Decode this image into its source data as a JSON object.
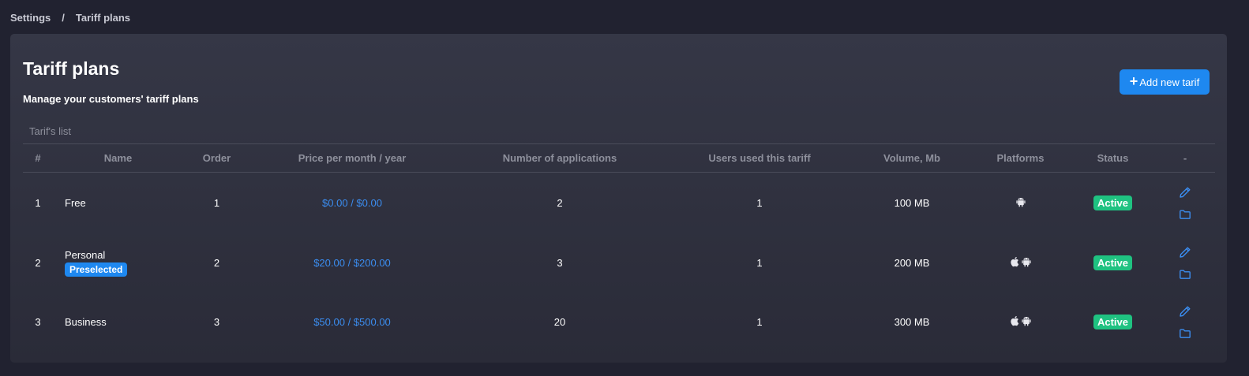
{
  "breadcrumb": {
    "root": "Settings",
    "separator": "/",
    "current": "Tariff plans"
  },
  "page": {
    "title": "Tariff plans",
    "subtitle": "Manage your customers' tariff plans",
    "add_button_label": "Add new tarif",
    "list_label": "Tarif's list"
  },
  "table": {
    "headers": {
      "num": "#",
      "name": "Name",
      "order": "Order",
      "price": "Price per month / year",
      "apps": "Number of applications",
      "users": "Users used this tariff",
      "volume": "Volume, Mb",
      "platforms": "Platforms",
      "status": "Status",
      "actions": "-"
    },
    "rows": [
      {
        "num": "1",
        "name": "Free",
        "badge": "",
        "order": "1",
        "price": "$0.00 / $0.00",
        "apps": "2",
        "users": "1",
        "volume": "100 MB",
        "platforms": [
          "android-icon"
        ],
        "status": "Active"
      },
      {
        "num": "2",
        "name": "Personal",
        "badge": "Preselected",
        "order": "2",
        "price": "$20.00 / $200.00",
        "apps": "3",
        "users": "1",
        "volume": "200 MB",
        "platforms": [
          "apple-icon",
          "android-icon"
        ],
        "status": "Active"
      },
      {
        "num": "3",
        "name": "Business",
        "badge": "",
        "order": "3",
        "price": "$50.00 / $500.00",
        "apps": "20",
        "users": "1",
        "volume": "300 MB",
        "platforms": [
          "apple-icon",
          "android-icon"
        ],
        "status": "Active"
      }
    ]
  },
  "colors": {
    "background": "#212230",
    "accent": "#1e88f0",
    "price_text": "#3b8df0",
    "status_active": "#1fc281"
  }
}
